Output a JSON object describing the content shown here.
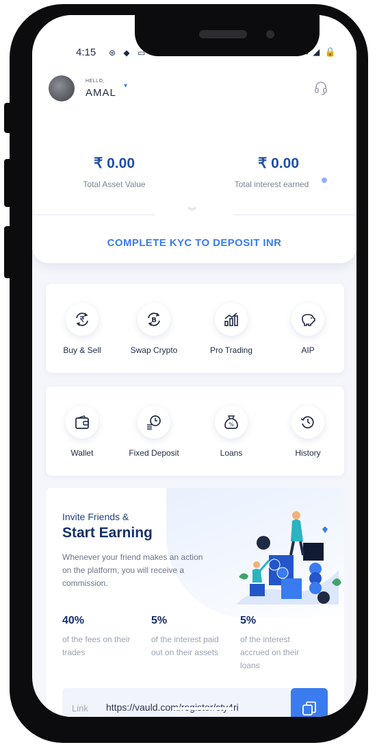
{
  "status_bar": {
    "time": "4:15",
    "left_icons": "⊛ ◆ ▭",
    "right_icons": "▼◢ 🔒"
  },
  "header": {
    "greeting": "HELLO,",
    "user_name": "AMAL",
    "caret": "▾"
  },
  "stats": [
    {
      "value": "₹ 0.00",
      "label": "Total Asset Value"
    },
    {
      "value": "₹ 0.00",
      "label": "Total interest earned"
    }
  ],
  "chevron": "︾",
  "kyc_prompt": "COMPLETE KYC TO DEPOSIT INR",
  "actions_row1": [
    {
      "label": "Buy & Sell",
      "icon": "rupee-exchange-icon"
    },
    {
      "label": "Swap Crypto",
      "icon": "bitcoin-swap-icon"
    },
    {
      "label": "Pro Trading",
      "icon": "trading-chart-icon"
    },
    {
      "label": "AIP",
      "icon": "piggy-bank-icon"
    }
  ],
  "actions_row2": [
    {
      "label": "Wallet",
      "icon": "wallet-icon"
    },
    {
      "label": "Fixed Deposit",
      "icon": "fixed-deposit-icon"
    },
    {
      "label": "Loans",
      "icon": "money-bag-icon"
    },
    {
      "label": "History",
      "icon": "history-icon"
    }
  ],
  "invite": {
    "kicker": "Invite Friends &",
    "title": "Start Earning",
    "description": "Whenever your friend makes an action on the platform, you will receive a commission.",
    "stats": [
      {
        "value": "40%",
        "label": "of the fees on their trades"
      },
      {
        "value": "5%",
        "label": "of the interest paid out on their assets"
      },
      {
        "value": "5%",
        "label": "of the interest accrued on their loans"
      }
    ],
    "link_label": "Link",
    "link_url": "https://vauld.com/register/cty4ri"
  },
  "colors": {
    "accent": "#3a7bef",
    "navy": "#15306b",
    "phone": "#0c0c0e"
  }
}
